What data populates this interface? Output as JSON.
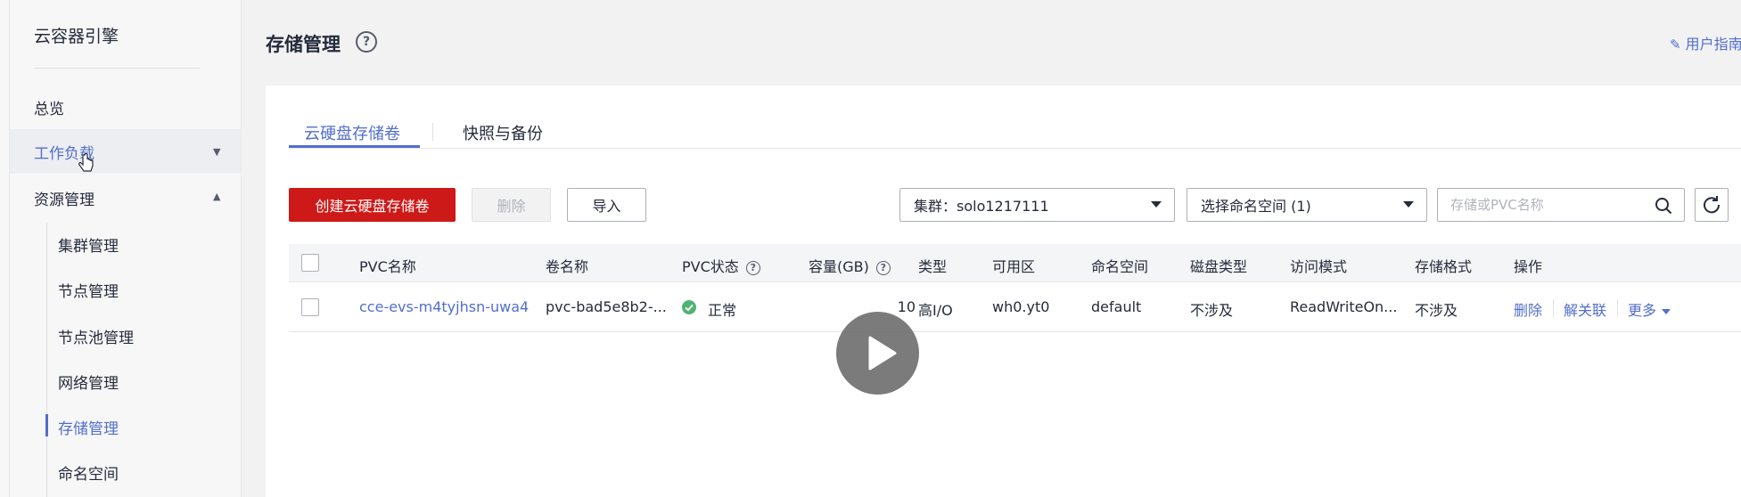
{
  "sidebar": {
    "title": "云容器引擎",
    "items": [
      {
        "label": "总览"
      },
      {
        "label": "工作负载"
      },
      {
        "label": "资源管理"
      }
    ],
    "sub_items": [
      {
        "label": "集群管理"
      },
      {
        "label": "节点管理"
      },
      {
        "label": "节点池管理"
      },
      {
        "label": "网络管理"
      },
      {
        "label": "存储管理"
      },
      {
        "label": "命名空间"
      }
    ]
  },
  "header": {
    "title": "存储管理",
    "help": "?",
    "guide_link": "用户指南"
  },
  "tabs": [
    {
      "label": "云硬盘存储卷"
    },
    {
      "label": "快照与备份"
    }
  ],
  "toolbar": {
    "create_label": "创建云硬盘存储卷",
    "delete_label": "删除",
    "import_label": "导入",
    "cluster_select": "集群：solo1217111",
    "namespace_select": "选择命名空间 (1)",
    "search_placeholder": "存储或PVC名称"
  },
  "table": {
    "columns": [
      "PVC名称",
      "卷名称",
      "PVC状态",
      "容量(GB)",
      "类型",
      "可用区",
      "命名空间",
      "磁盘类型",
      "访问模式",
      "存储格式",
      "操作"
    ],
    "help_glyph": "?",
    "rows": [
      {
        "pvc_name": "cce-evs-m4tyjhsn-uwa4",
        "volume_name": "pvc-bad5e8b2-...",
        "status": "正常",
        "capacity": "10",
        "type": "高I/O",
        "zone": "wh0.yt0",
        "namespace": "default",
        "disk_type": "不涉及",
        "access_mode": "ReadWriteOn...",
        "storage_format": "不涉及",
        "actions": {
          "delete": "删除",
          "unbind": "解关联",
          "more": "更多"
        }
      }
    ]
  },
  "colors": {
    "accent": "#526ecc",
    "primary_button": "#cd1a18",
    "status_ok": "#50b371"
  }
}
